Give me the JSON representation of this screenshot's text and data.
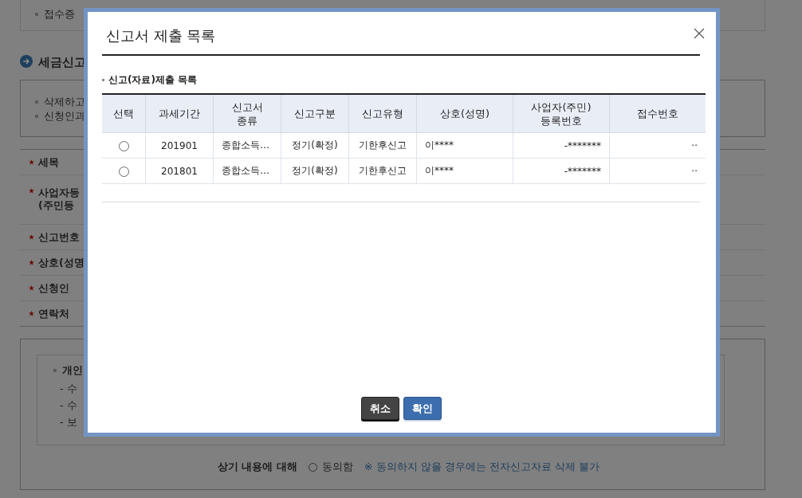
{
  "page": {
    "top_note": "접수증",
    "section_title": "세금신고",
    "notice_items": [
      "삭제하고",
      "신청인과"
    ],
    "form_rows": [
      {
        "label": "세목",
        "required": true,
        "tall": false
      },
      {
        "label": "사업자등\n(주민등",
        "required": true,
        "tall": true
      },
      {
        "label": "신고번호",
        "required": true,
        "tall": false
      },
      {
        "label": "상호(성명",
        "required": true,
        "tall": false
      },
      {
        "label": "신청인",
        "required": true,
        "tall": false
      },
      {
        "label": "연락처",
        "required": true,
        "tall": false
      }
    ],
    "privacy": {
      "title": "개인",
      "items": [
        "- 수",
        "- 수",
        "- 보"
      ]
    },
    "consent": {
      "label": "상기 내용에 대해",
      "option": "동의함",
      "checked": false,
      "note": "※ 동의하지 않을 경우에는 전자신고자료 삭제 불가"
    }
  },
  "dialog": {
    "title": "신고서 제출 목록",
    "subtitle": "신고(자료)제출 목록",
    "table": {
      "select_column": "선택",
      "columns": [
        "과세기간",
        "신고서\n종류",
        "신고구분",
        "신고유형",
        "상호(성명)",
        "사업자(주민)\n등록번호",
        "접수번호"
      ],
      "rows": [
        {
          "selected": false,
          "cells": [
            "201901",
            "종합소득…",
            "정기(확정)",
            "기한후신고",
            "이****",
            "-*******",
            "··"
          ]
        },
        {
          "selected": false,
          "cells": [
            "201801",
            "종합소득…",
            "정기(확정)",
            "기한후신고",
            "이****",
            "-*******",
            "··"
          ]
        }
      ]
    },
    "buttons": [
      {
        "label": "취소",
        "kind": "cancel"
      },
      {
        "label": "확인",
        "kind": "confirm"
      }
    ]
  }
}
